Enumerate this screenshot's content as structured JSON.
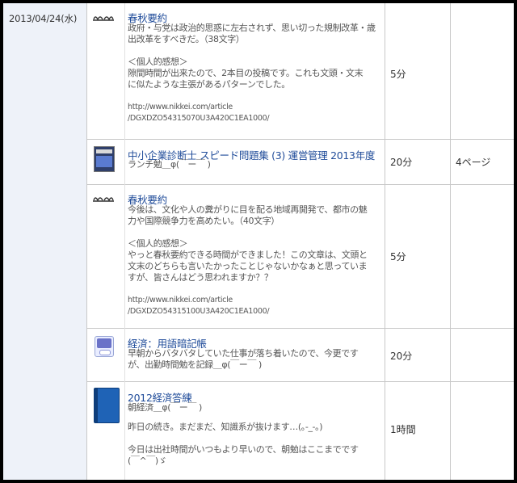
{
  "date": "2013/04/24(水)",
  "rows": [
    {
      "icon": "spectacles-icon",
      "title": "春秋要約",
      "body_lines": [
        "政府・与党は政治的思惑に左右されず、思い切った規制改革・歳",
        "出改革をすべきだ。（38文字）",
        "",
        "＜個人的感想＞",
        "隙間時間が出来たので、2本目の投稿です。これも文頭・文末",
        "に似たような主張があるパターンでした。",
        "",
        "http://www.nikkei.com/article",
        "/DGXDZO54315070U3A420C1EA1000/"
      ],
      "time": "5分",
      "pages": ""
    },
    {
      "icon": "book-cover-icon",
      "title": "中小企業診断士 スピード問題集 (3) 運営管理 2013年度",
      "body_lines": [
        "ランチ勉＿φ(￣ー￣ )"
      ],
      "time": "20分",
      "pages": "4ページ"
    },
    {
      "icon": "spectacles-icon",
      "title": "春秋要約",
      "body_lines": [
        "今後は、文化や人の糞がりに目を配る地域再開発で、都市の魅",
        "力や国際競争力を高めたい。（40文字）",
        "",
        "＜個人的感想＞",
        "やっと春秋要約できる時間ができました！この文章は、文頭と",
        "文末のどちらも言いたかったことじゃないかなぁと思っていま",
        "すが、皆さんはどう思われますか？？",
        "",
        "http://www.nikkei.com/article",
        "/DGXDZO54315100U3A420C1EA1000/"
      ],
      "time": "5分",
      "pages": ""
    },
    {
      "icon": "study-app-icon",
      "title": "経済：用語暗記帳",
      "body_lines": [
        "早朝からバタバタしていた仕事が落ち着いたので、今更です",
        "が、出勤時間勉を記録＿φ(￣ー￣ )"
      ],
      "time": "20分",
      "pages": ""
    },
    {
      "icon": "blue-book-icon",
      "title": "2012経済答練",
      "body_lines": [
        "朝経済＿φ(￣ー￣ )",
        "",
        "昨日の続き。まだまだ、知識系が抜けます…(｡-_-｡)",
        "",
        "今日は出社時間がいつもより早いので、朝勉はここまでです",
        "(￣^￣)ゞ"
      ],
      "time": "1時間",
      "pages": ""
    }
  ]
}
